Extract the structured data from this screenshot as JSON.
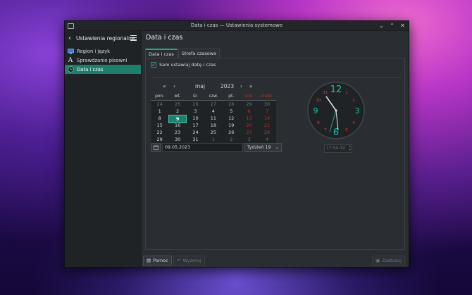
{
  "window": {
    "title": "Data i czas — Ustawienia systemowe"
  },
  "sidebar": {
    "title": "Ustawienia regionalne",
    "items": [
      {
        "label": "Region i język",
        "icon": "monitor-flag-icon"
      },
      {
        "label": "Sprawdzanie pisowni",
        "icon": "spellcheck-icon"
      },
      {
        "label": "Data i czas",
        "icon": "clock-icon",
        "active": true
      }
    ]
  },
  "main": {
    "page_title": "Data i czas",
    "tabs": [
      {
        "label": "Data i czas",
        "active": true
      },
      {
        "label": "Strefa czasowa",
        "active": false
      }
    ],
    "auto_datetime_label": "Sam ustawiaj datę i czas",
    "auto_datetime_checked": true
  },
  "calendar": {
    "month": "maj",
    "year": "2023",
    "weekday_headers": [
      "pon.",
      "wt.",
      "śr.",
      "czw.",
      "pt.",
      "sob.",
      "niedz."
    ],
    "weeks": [
      [
        "24",
        "25",
        "26",
        "27",
        "28",
        "29",
        "30"
      ],
      [
        "1",
        "2",
        "3",
        "4",
        "5",
        "6",
        "7"
      ],
      [
        "8",
        "9",
        "10",
        "11",
        "12",
        "13",
        "14"
      ],
      [
        "15",
        "16",
        "17",
        "18",
        "19",
        "20",
        "21"
      ],
      [
        "22",
        "23",
        "24",
        "25",
        "26",
        "27",
        "28"
      ],
      [
        "29",
        "30",
        "31",
        "1",
        "2",
        "3",
        "4"
      ]
    ],
    "selected_day": "9",
    "date_value": "09.05.2023",
    "week_label": "Tydzień 19"
  },
  "clock": {
    "numerals": {
      "twelve": "12",
      "three": "3",
      "six": "6",
      "nine": "9"
    },
    "time_value": "17:54:32",
    "accent": "#19c3a3",
    "minor_numerals_color": "#d9472b"
  },
  "footer": {
    "help_label": "Pomoc",
    "defaults_label": "Wyzeruj",
    "apply_label": "Zastosuj"
  },
  "colors": {
    "accent": "#1f7f6d",
    "weekend": "#b0332b"
  }
}
